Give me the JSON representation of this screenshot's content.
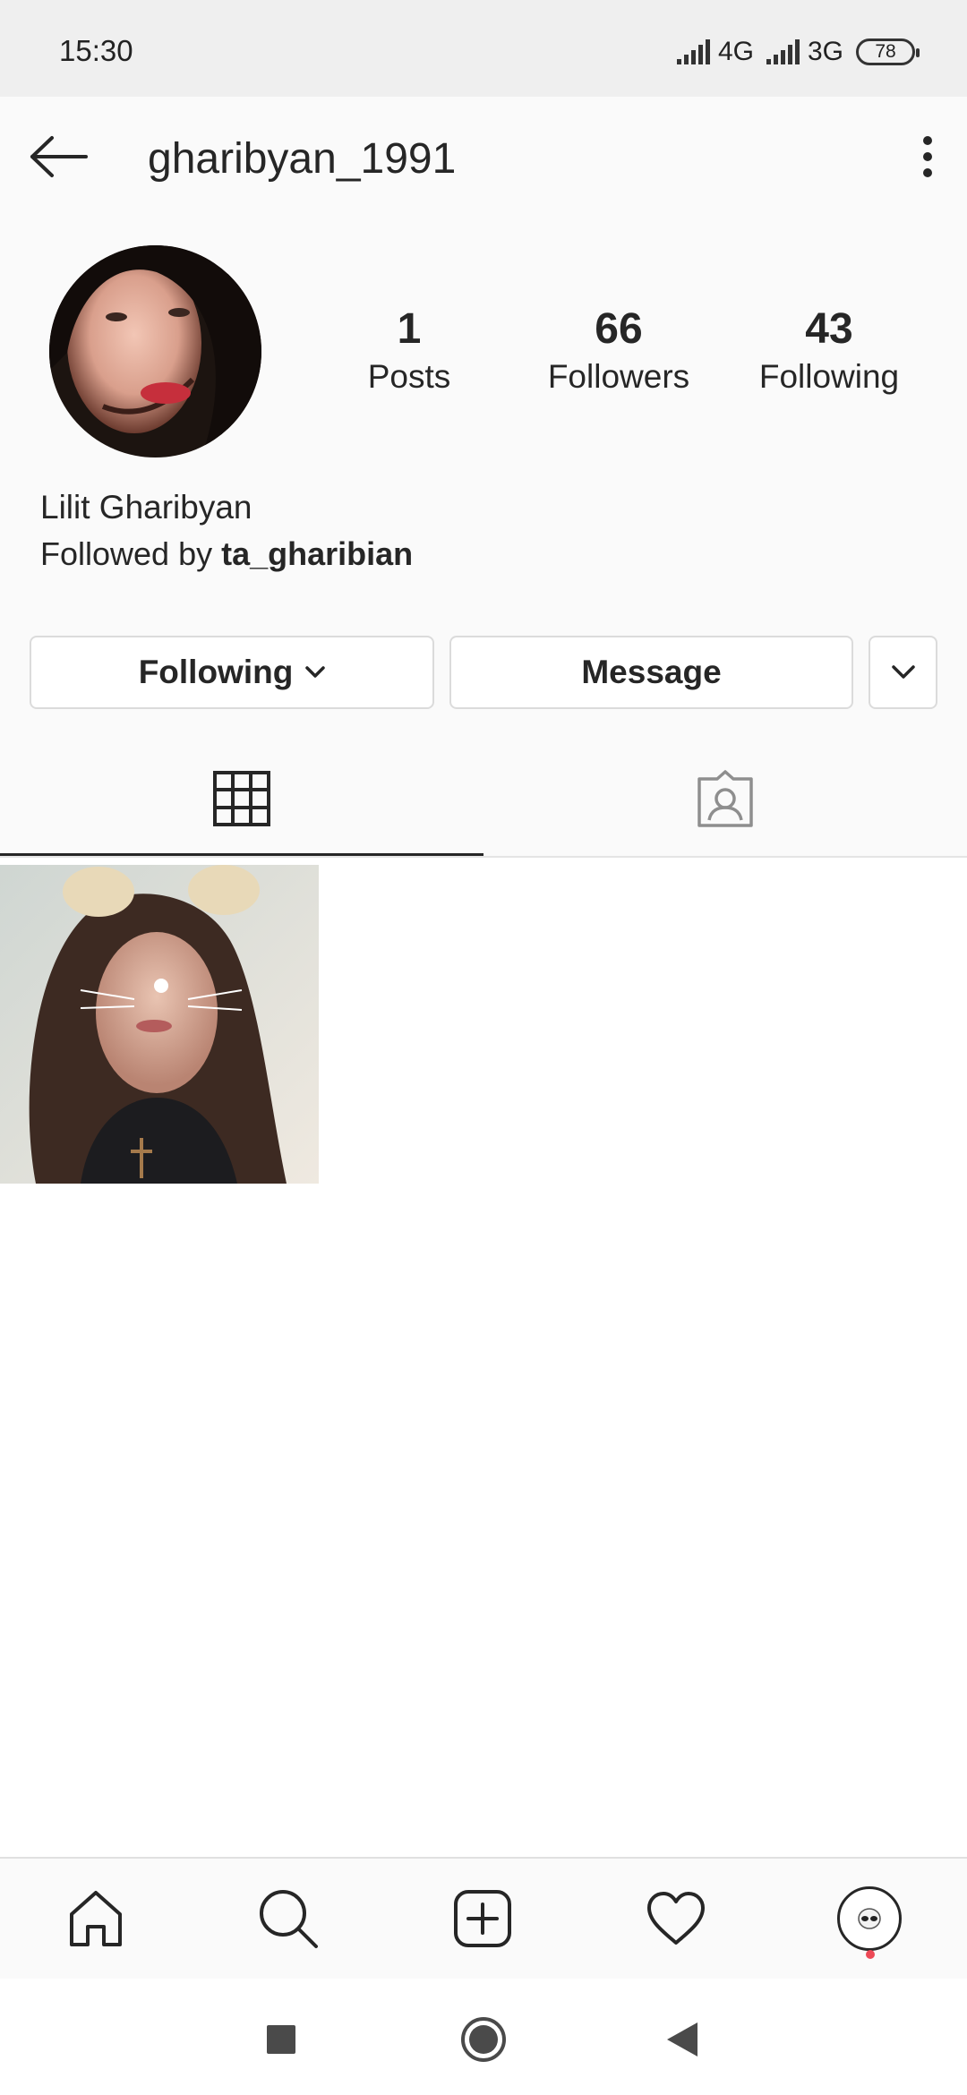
{
  "status_bar": {
    "time": "15:30",
    "network_1": "4G",
    "network_2": "3G",
    "battery": "78"
  },
  "header": {
    "username": "gharibyan_1991",
    "back_icon": "arrow-left-icon",
    "more_icon": "vertical-dots-icon"
  },
  "profile": {
    "stats": [
      {
        "value": "1",
        "label": "Posts"
      },
      {
        "value": "66",
        "label": "Followers"
      },
      {
        "value": "43",
        "label": "Following"
      }
    ],
    "full_name": "Lilit Gharibyan",
    "followed_by_prefix": "Followed by ",
    "followed_by_user": "ta_gharibian"
  },
  "actions": {
    "following_label": "Following",
    "message_label": "Message"
  },
  "tabs": [
    {
      "icon": "grid-icon",
      "active": true
    },
    {
      "icon": "tagged-person-icon",
      "active": false
    }
  ],
  "bottom_nav": [
    {
      "icon": "home-icon"
    },
    {
      "icon": "search-icon"
    },
    {
      "icon": "new-post-icon"
    },
    {
      "icon": "heart-icon"
    },
    {
      "icon": "profile-avatar-icon"
    }
  ],
  "system_nav": [
    {
      "icon": "recents-square-icon"
    },
    {
      "icon": "home-circle-icon"
    },
    {
      "icon": "back-triangle-icon"
    }
  ],
  "colors": {
    "text": "#262626",
    "border": "#dbdbdb",
    "background": "#fafafa",
    "notification": "#ed4956"
  }
}
